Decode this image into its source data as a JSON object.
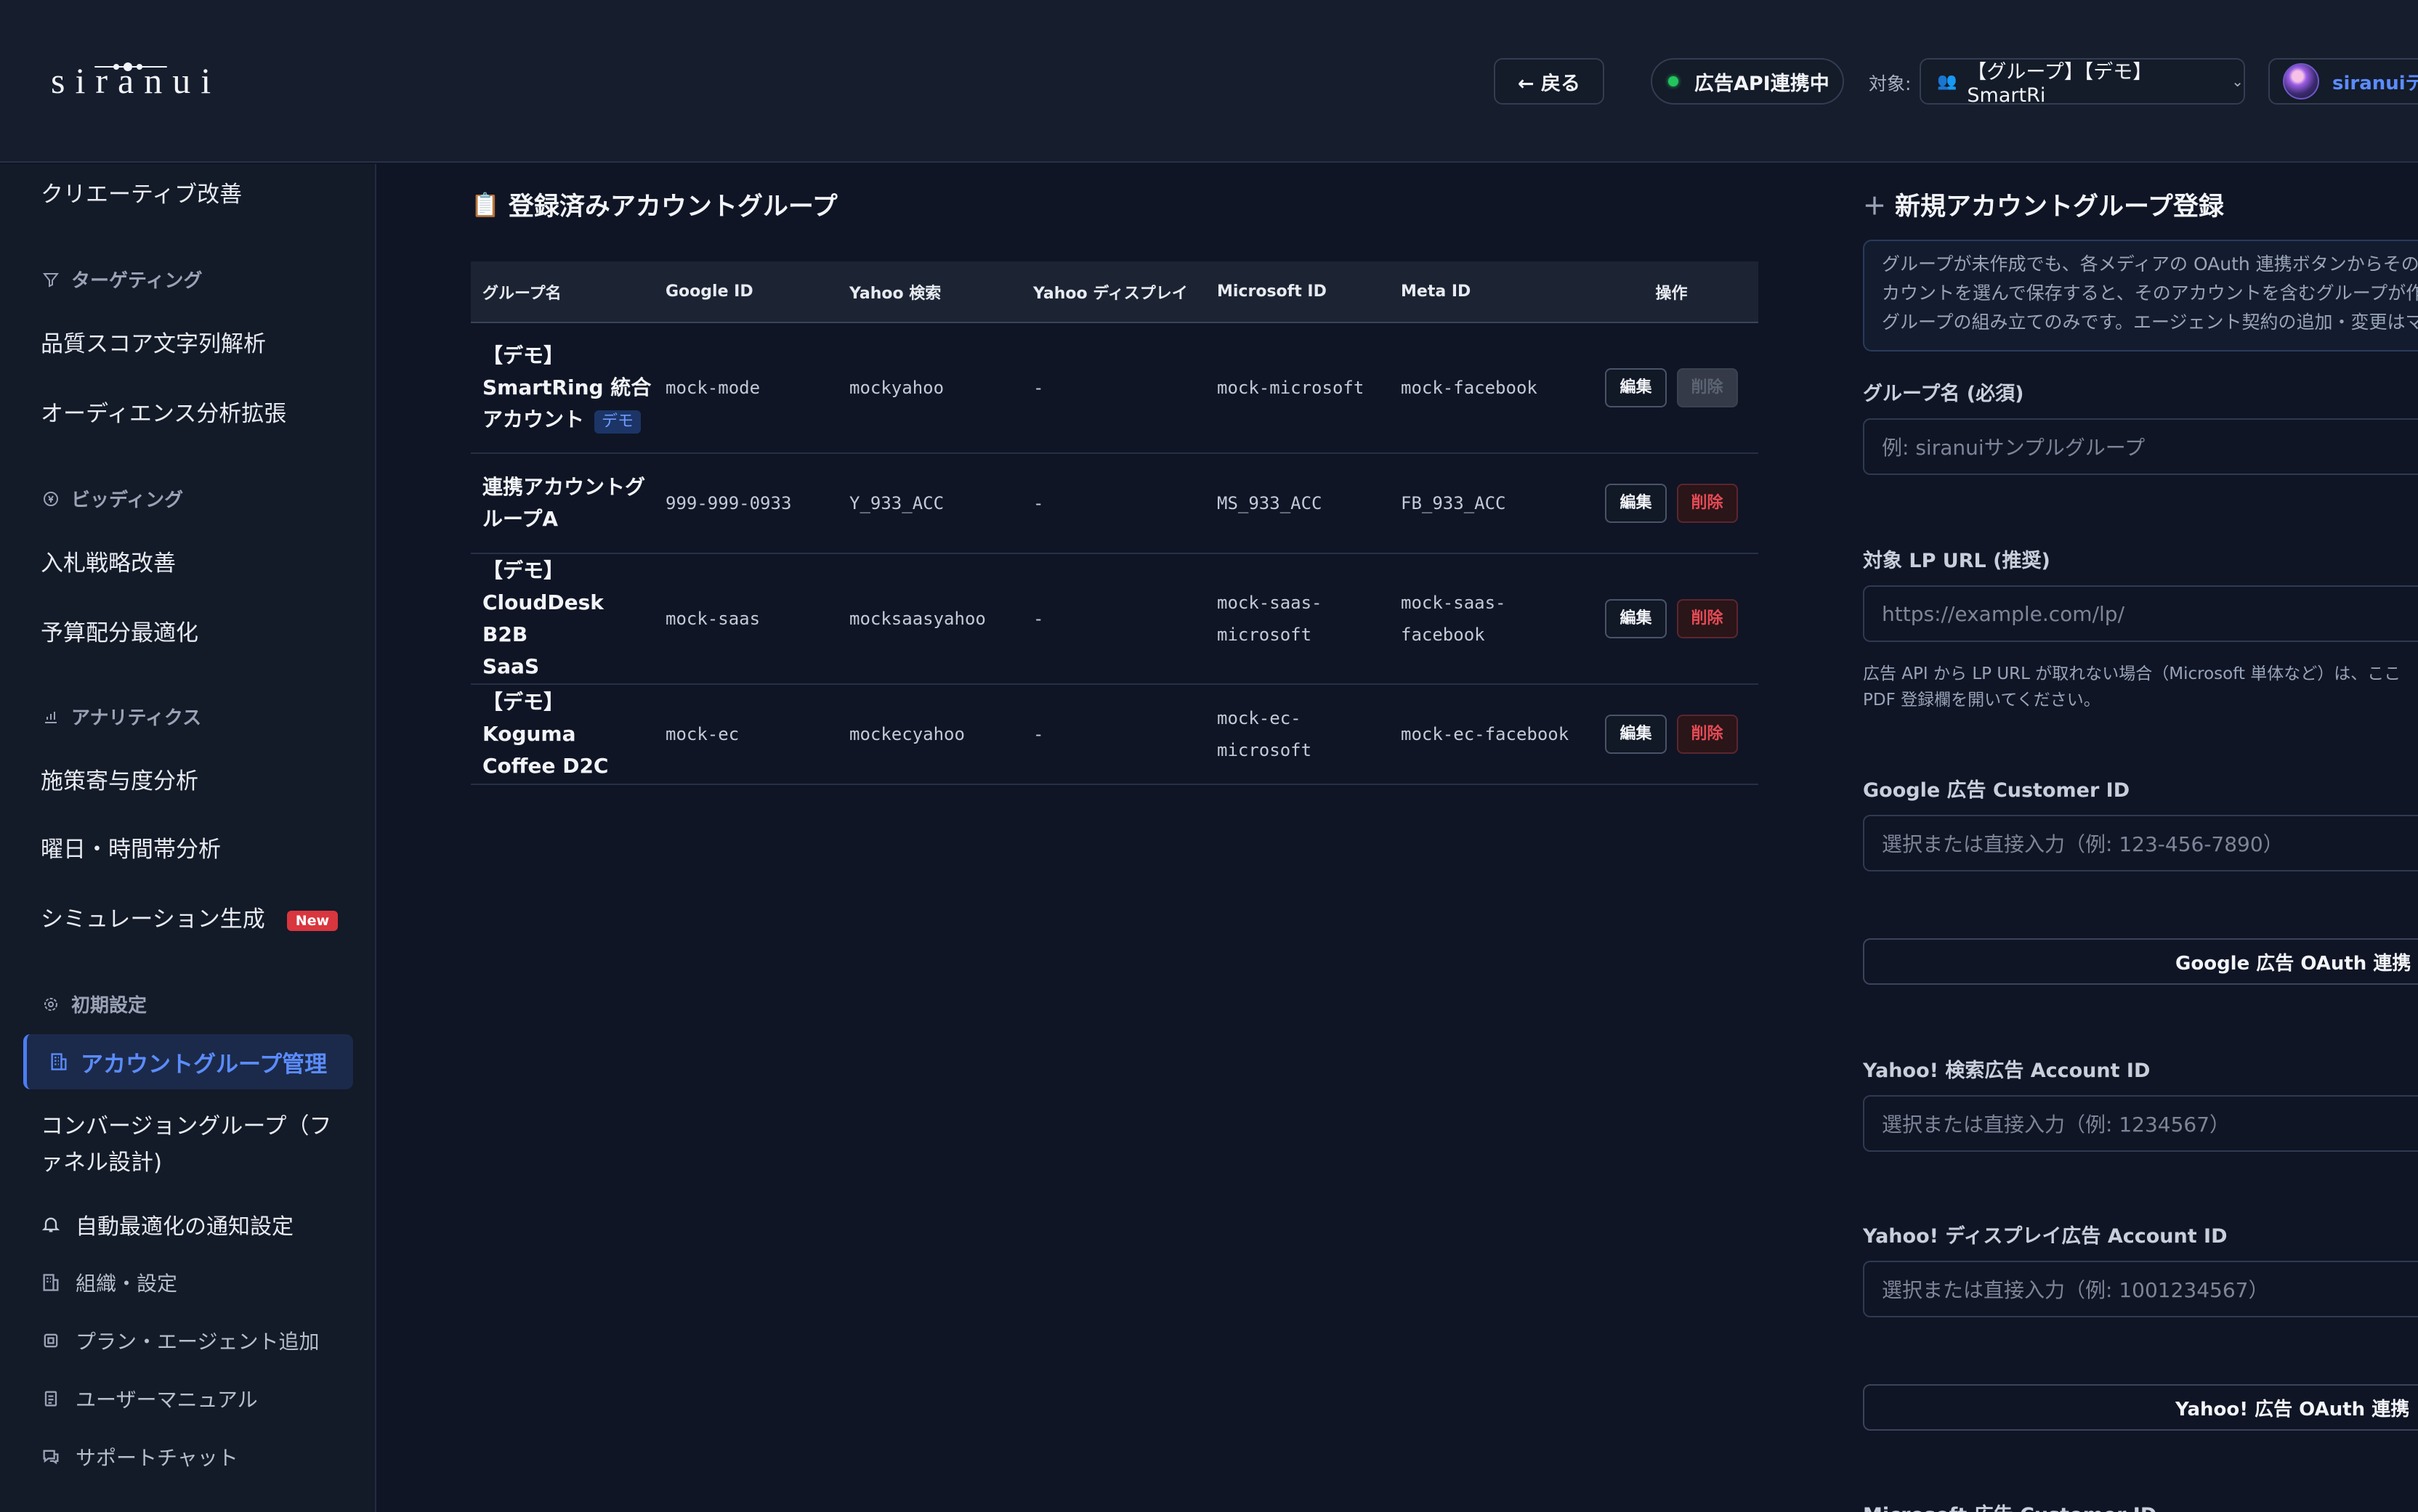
{
  "header": {
    "logo": "siranui",
    "back_label": "← 戻る",
    "api_status": "広告API連携中",
    "target_label": "対象:",
    "target_value": "【グループ】【デモ】SmartRi",
    "user_name": "siranuiデモ"
  },
  "sidebar": {
    "top_item": "クリエーティブ改善",
    "sections": {
      "targeting": "ターゲティング",
      "bidding": "ビッディング",
      "analytics": "アナリティクス",
      "initial": "初期設定"
    },
    "items": {
      "quality_score": "品質スコア文字列解析",
      "audience": "オーディエンス分析拡張",
      "bid_strategy": "入札戦略改善",
      "budget": "予算配分最適化",
      "contribution": "施策寄与度分析",
      "day_time": "曜日・時間帯分析",
      "simulation": "シミュレーション生成",
      "account_group": "アカウントグループ管理",
      "conversion_group_1": "コンバージョングループ（フ",
      "conversion_group_2": "ァネル設計)",
      "notification": "自動最適化の通知設定",
      "org": "組織・設定",
      "plan": "プラン・エージェント追加",
      "manual": "ユーザーマニュアル",
      "support": "サポートチャット"
    },
    "new_badge": "New"
  },
  "main": {
    "title": "登録済みアカウントグループ",
    "columns": [
      "グループ名",
      "Google ID",
      "Yahoo 検索",
      "Yahoo ディスプレイ",
      "Microsoft ID",
      "Meta ID",
      "操作"
    ],
    "rows": [
      {
        "name_lines": [
          "【デモ】",
          "SmartRing 統合",
          "アカウント"
        ],
        "tag": "デモ",
        "google": "mock-mode",
        "yahoo_search": "mockyahoo",
        "yahoo_display": "-",
        "microsoft": [
          "mock-microsoft"
        ],
        "meta": [
          "mock-facebook"
        ],
        "edit": "編集",
        "delete": "削除",
        "delete_disabled": true
      },
      {
        "name_lines": [
          "連携アカウントグ",
          "ループA"
        ],
        "tag": "",
        "google": "999-999-0933",
        "yahoo_search": "Y_933_ACC",
        "yahoo_display": "-",
        "microsoft": [
          "MS_933_ACC"
        ],
        "meta": [
          "FB_933_ACC"
        ],
        "edit": "編集",
        "delete": "削除",
        "delete_disabled": false
      },
      {
        "name_lines": [
          "【デモ】",
          "CloudDesk B2B",
          "SaaS"
        ],
        "tag": "",
        "google": "mock-saas",
        "yahoo_search": "mocksaasyahoo",
        "yahoo_display": "-",
        "microsoft": [
          "mock-saas-",
          "microsoft"
        ],
        "meta": [
          "mock-saas-",
          "facebook"
        ],
        "edit": "編集",
        "delete": "削除",
        "delete_disabled": false
      },
      {
        "name_lines": [
          "【デモ】Koguma",
          "Coffee D2C"
        ],
        "tag": "",
        "google": "mock-ec",
        "yahoo_search": "mockecyahoo",
        "yahoo_display": "-",
        "microsoft": [
          "mock-ec-",
          "microsoft"
        ],
        "meta": [
          "mock-ec-facebook"
        ],
        "edit": "編集",
        "delete": "削除",
        "delete_disabled": false
      }
    ]
  },
  "form": {
    "title": "新規アカウントグループ登録",
    "info_lines": [
      "グループが未作成でも、各メディアの OAuth 連携ボタンからその場",
      "カウントを選んで保存すると、そのアカウントを含むグループが作",
      "グループの組み立てのみです。エージェント契約の追加・変更はマ"
    ],
    "group_name_label": "グループ名 (必須)",
    "group_name_placeholder": "例: siranuiサンプルグループ",
    "lp_label": "対象 LP URL (推奨)",
    "lp_placeholder": "https://example.com/lp/",
    "lp_help_1": "広告 API から LP URL が取れない場合（Microsoft 単体など）は、ここ",
    "lp_help_2": "PDF 登録欄を開いてください。",
    "google_label": "Google 広告 Customer ID",
    "google_placeholder": "選択または直接入力（例: 123-456-7890）",
    "google_oauth": "Google 広告 OAuth 連携",
    "yahoo_search_label": "Yahoo! 検索広告 Account ID",
    "yahoo_search_placeholder": "選択または直接入力（例: 1234567）",
    "yahoo_display_label": "Yahoo! ディスプレイ広告 Account ID",
    "yahoo_display_placeholder": "選択または直接入力（例: 1001234567）",
    "yahoo_oauth": "Yahoo! 広告 OAuth 連携",
    "microsoft_label": "Microsoft 広告 Customer ID"
  }
}
